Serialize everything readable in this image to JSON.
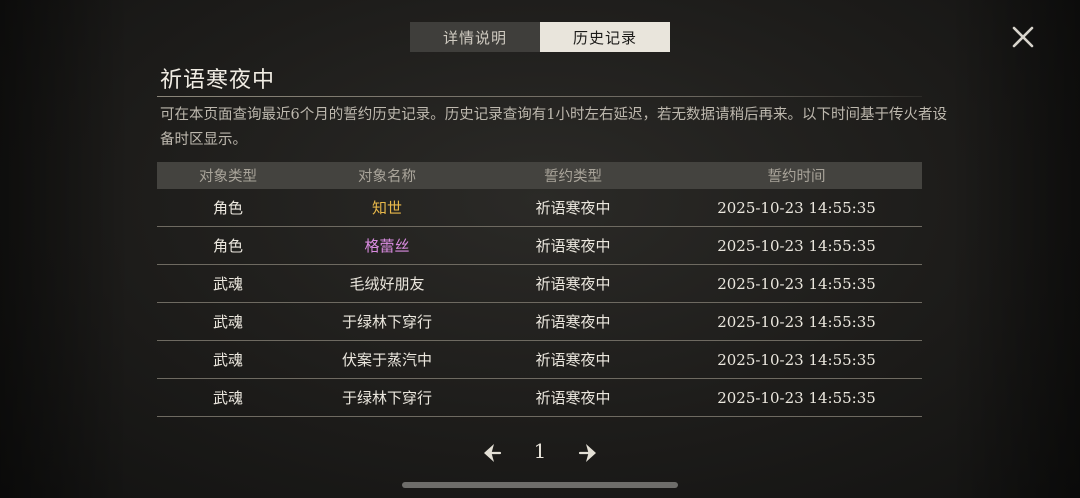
{
  "tabs": [
    {
      "label": "详情说明",
      "active": false
    },
    {
      "label": "历史记录",
      "active": true
    }
  ],
  "title": "祈语寒夜中",
  "description": "可在本页面查询最近6个月的誓约历史记录。历史记录查询有1小时左右延迟，若无数据请稍后再来。以下时间基于传火者设备时区显示。",
  "table": {
    "headers": [
      "对象类型",
      "对象名称",
      "誓约类型",
      "誓约时间"
    ],
    "rows": [
      {
        "type": "角色",
        "name": "知世",
        "name_color": "#e8b84a",
        "oath": "祈语寒夜中",
        "time": "2025-10-23 14:55:35"
      },
      {
        "type": "角色",
        "name": "格蕾丝",
        "name_color": "#d98be0",
        "oath": "祈语寒夜中",
        "time": "2025-10-23 14:55:35"
      },
      {
        "type": "武魂",
        "name": "毛绒好朋友",
        "name_color": "#ebe7de",
        "oath": "祈语寒夜中",
        "time": "2025-10-23 14:55:35"
      },
      {
        "type": "武魂",
        "name": "于绿林下穿行",
        "name_color": "#ebe7de",
        "oath": "祈语寒夜中",
        "time": "2025-10-23 14:55:35"
      },
      {
        "type": "武魂",
        "name": "伏案于蒸汽中",
        "name_color": "#ebe7de",
        "oath": "祈语寒夜中",
        "time": "2025-10-23 14:55:35"
      },
      {
        "type": "武魂",
        "name": "于绿林下穿行",
        "name_color": "#ebe7de",
        "oath": "祈语寒夜中",
        "time": "2025-10-23 14:55:35"
      }
    ]
  },
  "pagination": {
    "page": "1"
  },
  "icons": {
    "close": "close-icon",
    "prev": "arrow-left-icon",
    "next": "arrow-right-icon"
  }
}
